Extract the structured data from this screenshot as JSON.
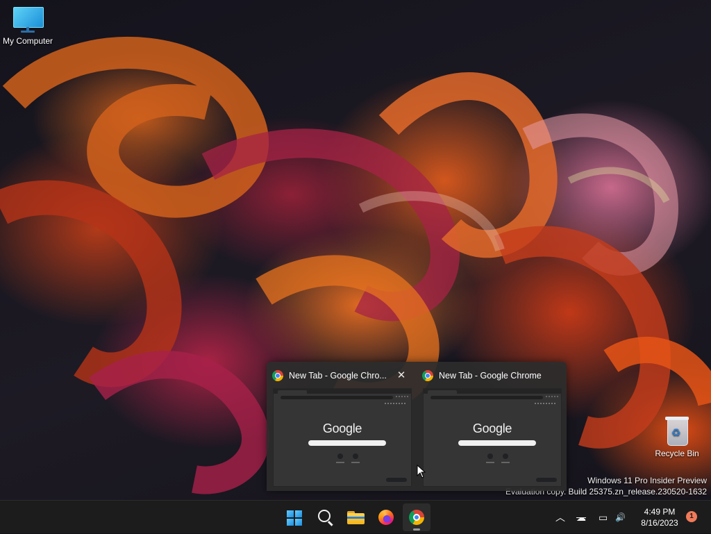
{
  "desktop": {
    "icons": [
      {
        "label": "My Computer",
        "icon": "monitor-icon"
      },
      {
        "label": "Recycle Bin",
        "icon": "recycle-bin-icon"
      }
    ],
    "watermark": {
      "line1": "Windows 11 Pro Insider Preview",
      "line2": "Evaluation copy. Build 25375.zn_release.230520-1632"
    }
  },
  "thumbnails": [
    {
      "title": "New Tab - Google Chro...",
      "has_close": true,
      "close_glyph": "✕",
      "preview_logo": "Google"
    },
    {
      "title": "New Tab - Google Chrome",
      "has_close": false,
      "preview_logo": "Google"
    }
  ],
  "taskbar": {
    "apps": [
      {
        "name": "Start",
        "icon": "windows-start-icon"
      },
      {
        "name": "Search",
        "icon": "search-icon"
      },
      {
        "name": "File Explorer",
        "icon": "folder-icon"
      },
      {
        "name": "Firefox",
        "icon": "firefox-icon"
      },
      {
        "name": "Google Chrome",
        "icon": "chrome-icon",
        "active": true
      }
    ],
    "tray": {
      "overflow_glyph": "︿",
      "network_glyph": "☁",
      "display_glyph": "▭",
      "volume_glyph": "🔊"
    },
    "clock": {
      "time": "4:49 PM",
      "date": "8/16/2023"
    },
    "notification_count": "1"
  }
}
